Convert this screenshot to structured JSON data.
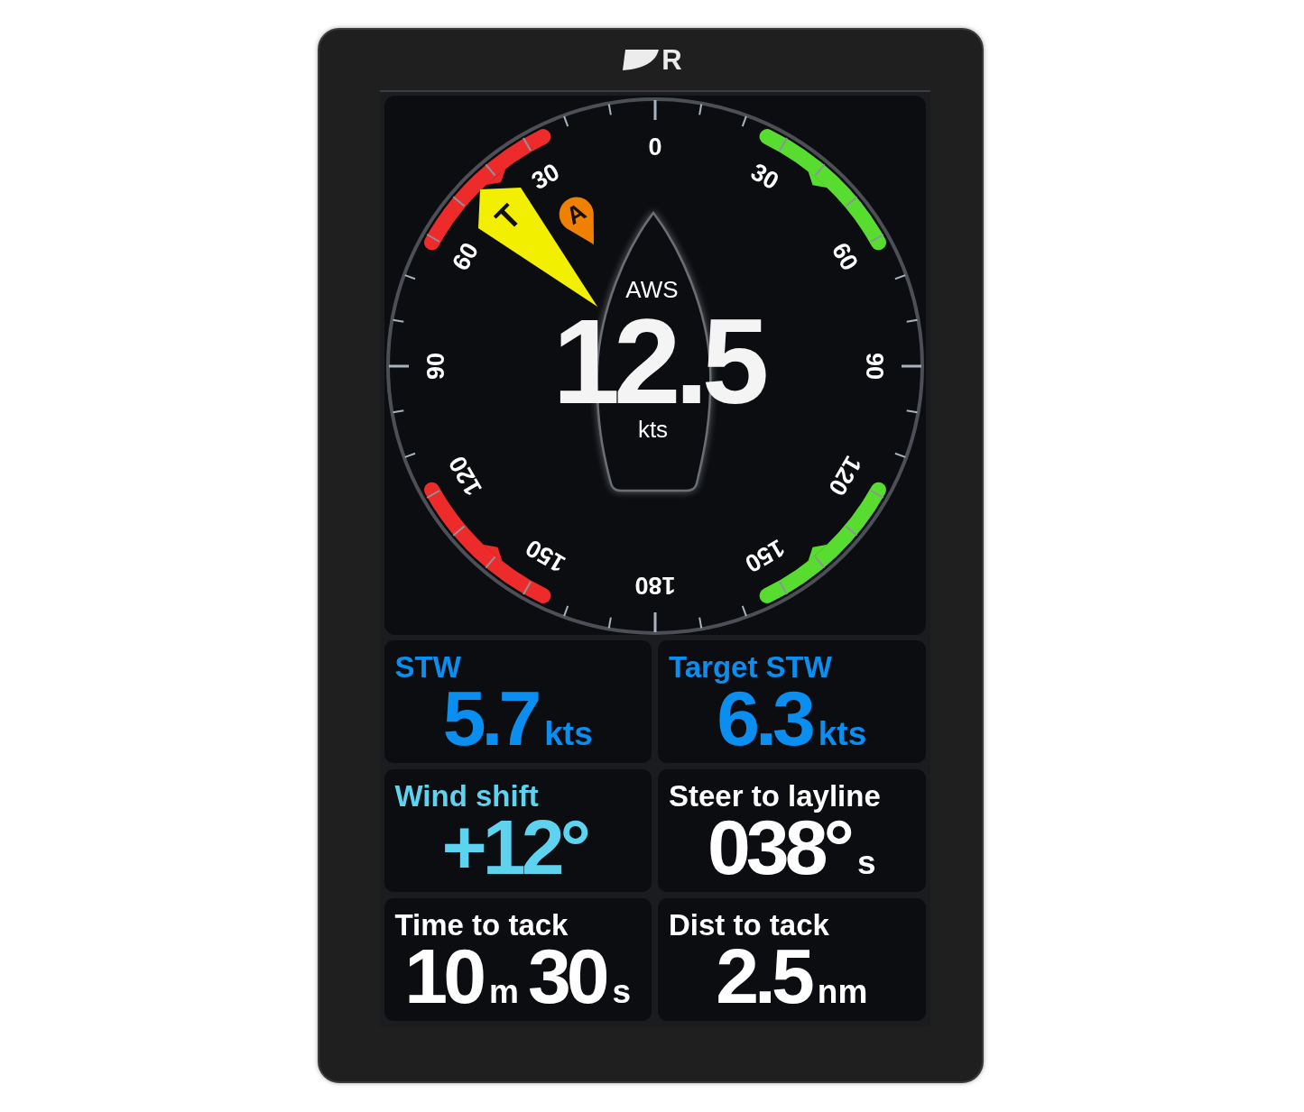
{
  "logo": {
    "letter": "R"
  },
  "dial": {
    "scale_labels": [
      "0",
      "30",
      "60",
      "90",
      "120",
      "150",
      "180",
      "150",
      "120",
      "90",
      "60",
      "30"
    ],
    "true_wind_marker": "T",
    "apparent_wind_marker": "A",
    "readout": {
      "label": "AWS",
      "value": "12.5",
      "unit": "kts"
    }
  },
  "tiles": [
    {
      "label": "STW",
      "color": "#0a8ff0",
      "value": [
        {
          "kind": "number",
          "text": "5.7"
        },
        {
          "kind": "unit",
          "text": "kts"
        }
      ]
    },
    {
      "label": "Target STW",
      "color": "#0a8ff0",
      "value": [
        {
          "kind": "number",
          "text": "6.3"
        },
        {
          "kind": "unit",
          "text": "kts"
        }
      ]
    },
    {
      "label": "Wind shift",
      "color": "#5dd3ef",
      "value": [
        {
          "kind": "number",
          "text": "+12°"
        }
      ]
    },
    {
      "label": "Steer to layline",
      "color": "#ffffff",
      "value": [
        {
          "kind": "number",
          "text": "038°"
        },
        {
          "kind": "unit",
          "text": "s"
        }
      ]
    },
    {
      "label": "Time to tack",
      "color": "#ffffff",
      "value": [
        {
          "kind": "number",
          "text": "10"
        },
        {
          "kind": "unit",
          "text": "m"
        },
        {
          "kind": "number",
          "text": "30"
        },
        {
          "kind": "unit",
          "text": "s"
        }
      ]
    },
    {
      "label": "Dist to tack",
      "color": "#ffffff",
      "value": [
        {
          "kind": "number",
          "text": "2.5"
        },
        {
          "kind": "unit",
          "text": "nm"
        }
      ]
    }
  ]
}
